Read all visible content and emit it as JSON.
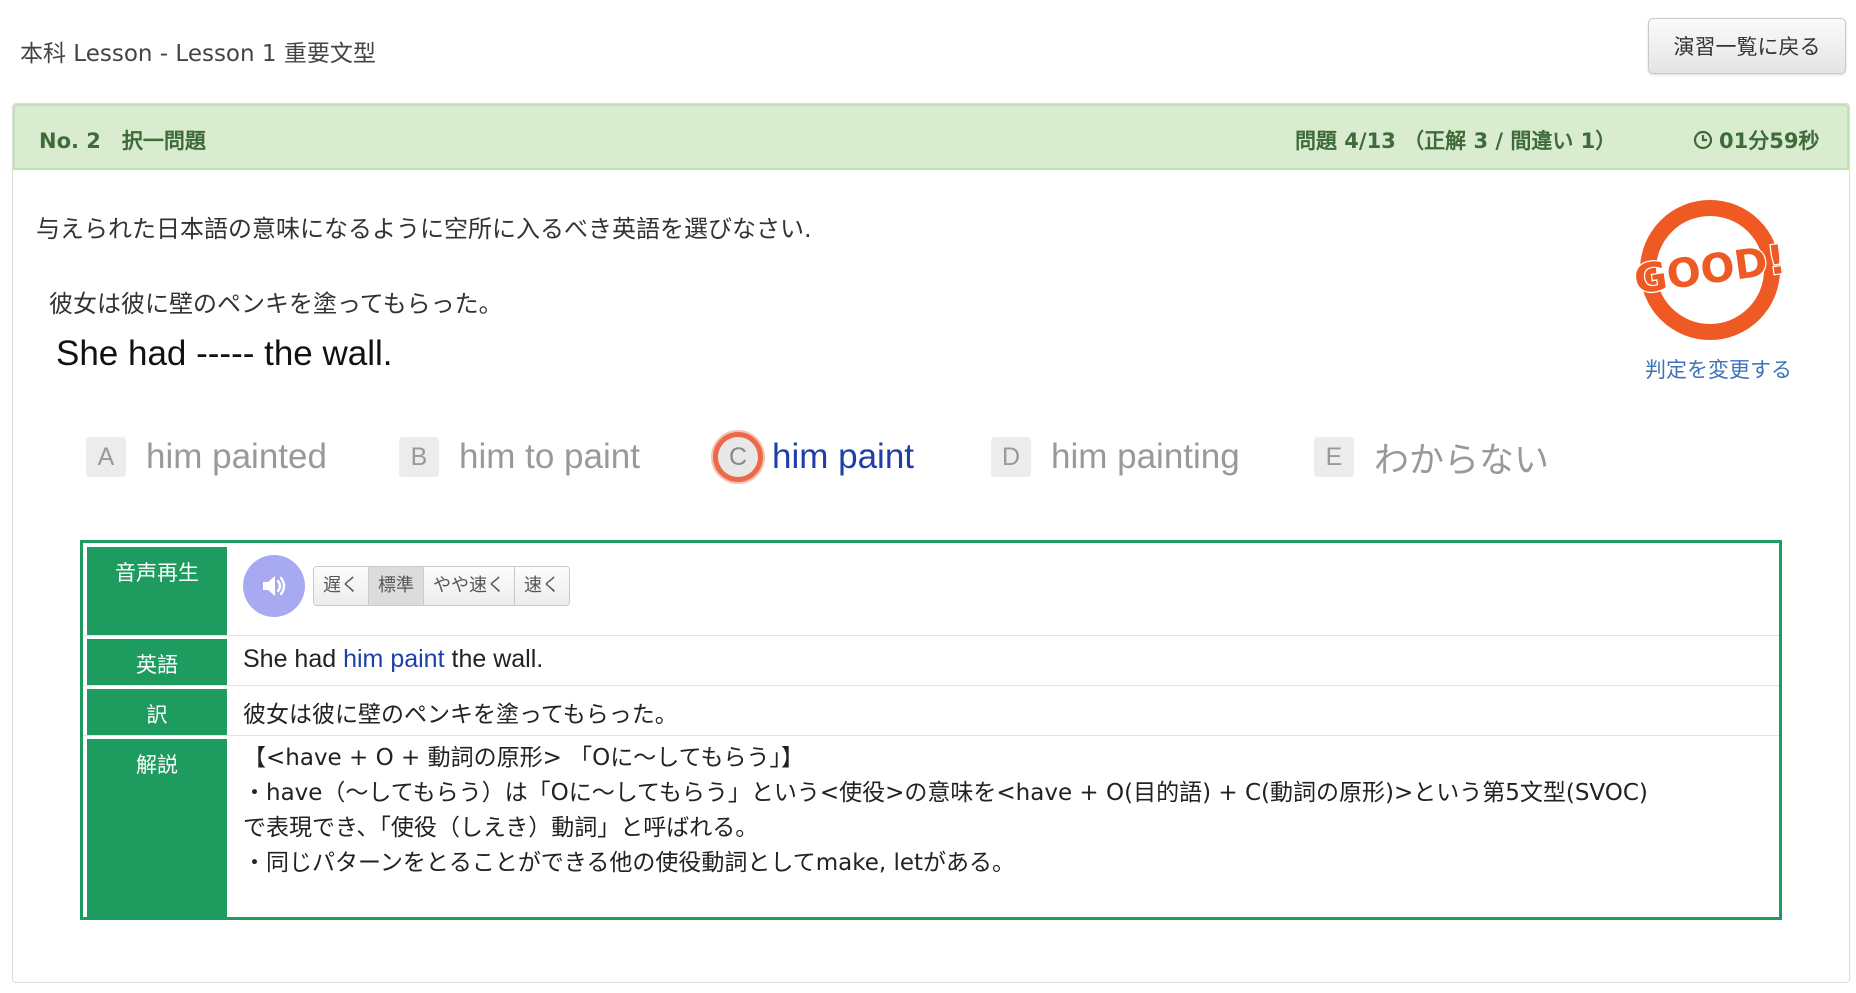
{
  "breadcrumb": "本科 Lesson - Lesson 1 重要文型",
  "back_button": "演習一覧に戻る",
  "header": {
    "question_number": "No. 2　択一問題",
    "progress": "問題 4/13 （正解 3 / 間違い 1）",
    "timer": "01分59秒"
  },
  "instruction": "与えられた日本語の意味になるように空所に入るべき英語を選びなさい.",
  "japanese_sentence": "彼女は彼に壁のペンキを塗ってもらった。",
  "english_sentence": "She had ----- the wall.",
  "judgement": {
    "stamp": "GOOD!",
    "change_link": "判定を変更する"
  },
  "choices": [
    {
      "letter": "A",
      "text": "him painted",
      "selected": false
    },
    {
      "letter": "B",
      "text": "him to paint",
      "selected": false
    },
    {
      "letter": "C",
      "text": "him paint",
      "selected": true
    },
    {
      "letter": "D",
      "text": "him painting",
      "selected": false
    },
    {
      "letter": "E",
      "text": "わからない",
      "selected": false
    }
  ],
  "detail": {
    "audio_label": "音声再生",
    "speeds": [
      "遅く",
      "標準",
      "やや速く",
      "速く"
    ],
    "active_speed": "標準",
    "english_label": "英語",
    "english_before": "She had ",
    "english_highlight": "him paint",
    "english_after": " the wall.",
    "translation_label": "訳",
    "translation": "彼女は彼に壁のペンキを塗ってもらった。",
    "explanation_label": "解説",
    "explanation_lines": [
      "【<have + O + 動詞の原形> 「Oに～してもらう」】",
      "・have（～してもらう）は「Oに～してもらう」という<使役>の意味を<have + O(目的語) + C(動詞の原形)>という第5文型(SVOC)",
      "で表現でき、「使役（しえき）動詞」と呼ばれる。",
      "・同じパターンをとることができる他の使役動詞としてmake, letがある。"
    ]
  },
  "colors": {
    "accent_green": "#1e9b5e",
    "header_green": "#d9ecd0",
    "selected_blue": "#1f3fa8",
    "stamp_orange": "#ef5a24"
  }
}
